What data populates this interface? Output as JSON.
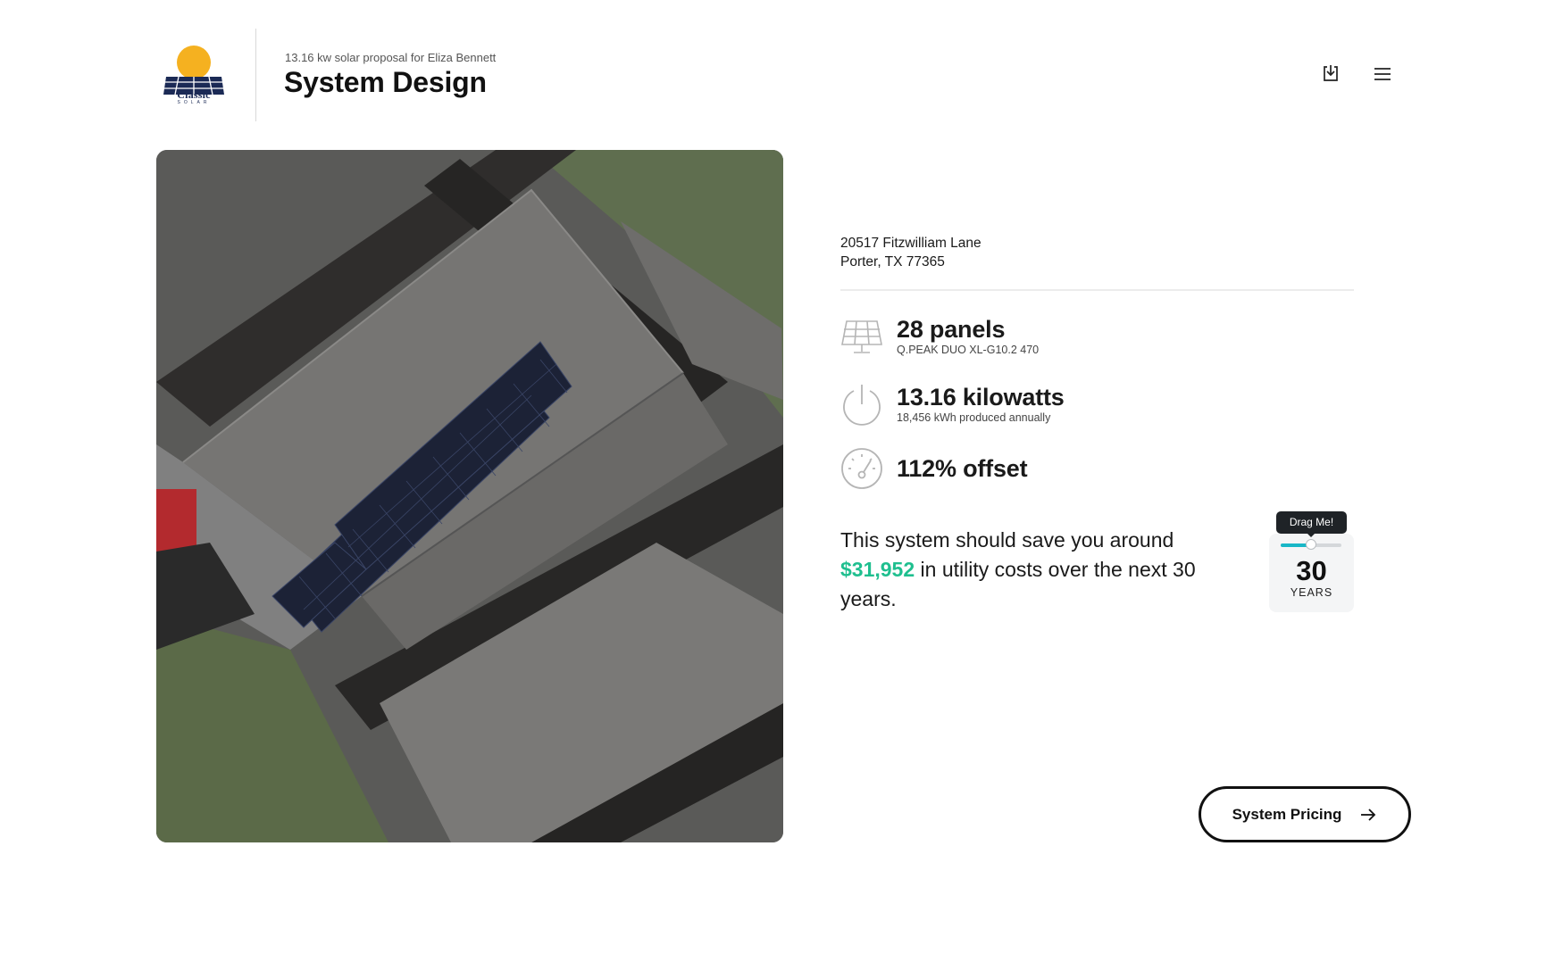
{
  "header": {
    "logo_text": "Classic",
    "logo_sub": "SOLAR",
    "subtitle": "13.16 kw solar proposal for Eliza Bennett",
    "title": "System Design",
    "download_icon": "download-icon",
    "menu_icon": "hamburger-menu-icon"
  },
  "address": {
    "line1": "20517 Fitzwilliam Lane",
    "line2": "Porter, TX 77365"
  },
  "stats": {
    "panels": {
      "main": "28 panels",
      "sub": "Q.PEAK DUO XL-G10.2 470",
      "icon": "solar-panel-icon"
    },
    "power": {
      "main": "13.16 kilowatts",
      "sub": "18,456 kWh produced annually",
      "icon": "power-icon"
    },
    "offset": {
      "main": "112% offset",
      "icon": "gauge-icon"
    }
  },
  "savings": {
    "prefix": "This system should save you around",
    "amount": "$31,952",
    "suffix": "in utility costs over the next 30 years."
  },
  "year_slider": {
    "tooltip": "Drag Me!",
    "value": "30",
    "unit": "YEARS",
    "fill_fraction": 0.5
  },
  "cta": {
    "label": "System Pricing",
    "icon": "arrow-right-icon"
  },
  "colors": {
    "accent_green": "#1fbf8f",
    "slider_teal": "#19b7c7",
    "logo_sun": "#f5b120",
    "logo_navy": "#1b2a55"
  }
}
